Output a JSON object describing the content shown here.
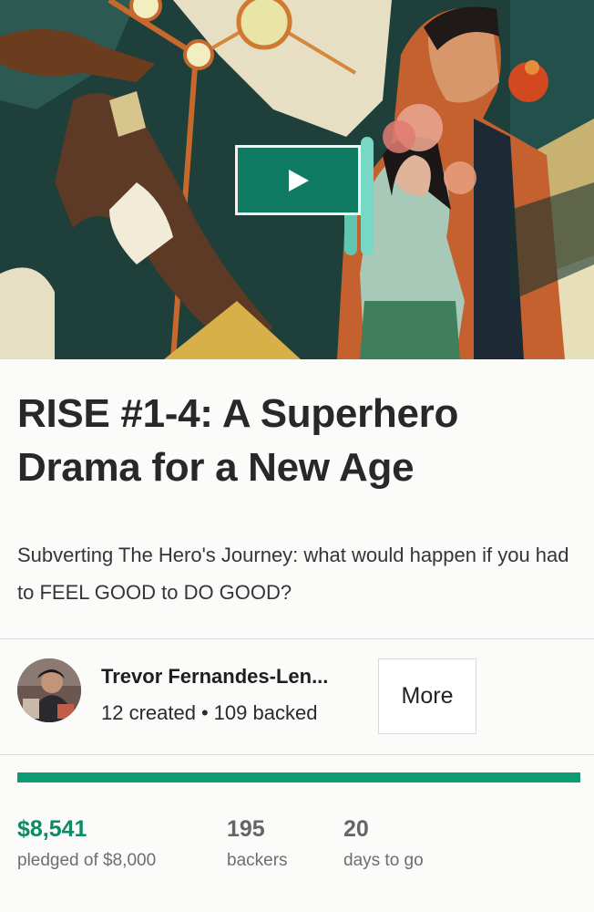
{
  "hero": {
    "play_icon": "play-icon",
    "accent": "#0d7a61"
  },
  "project": {
    "title": "RISE #1-4: A Superhero Drama for a New Age",
    "blurb": "Subverting The Hero's Journey: what would happen if you had to FEEL GOOD to DO GOOD?"
  },
  "creator": {
    "name": "Trevor Fernandes-Len...",
    "created": "12 created",
    "separator": "•",
    "backed": "109 backed",
    "more_label": "More"
  },
  "funding": {
    "progress_percent": 100,
    "pledged": "$8,541",
    "pledged_label": "pledged of $8,000",
    "backers": "195",
    "backers_label": "backers",
    "days": "20",
    "days_label": "days to go",
    "progress_color": "#0d9b74",
    "pledged_color": "#0d8a66"
  }
}
